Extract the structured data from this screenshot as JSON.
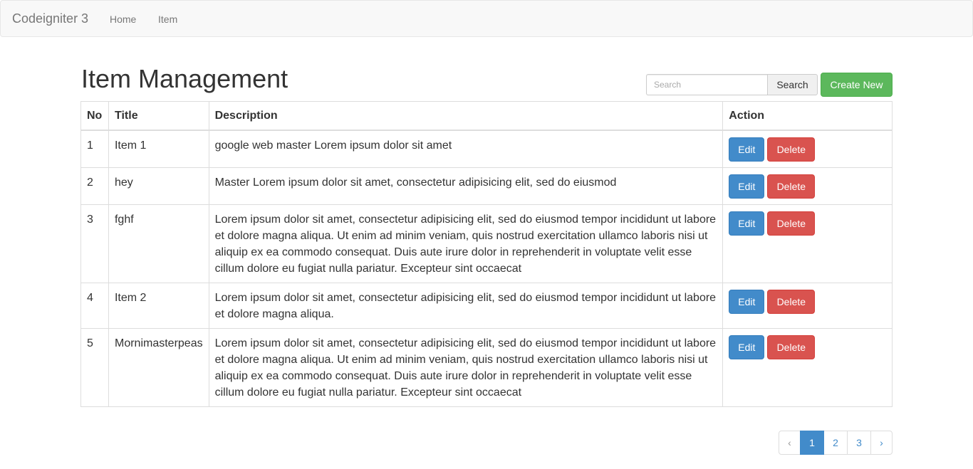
{
  "navbar": {
    "brand": "Codeigniter 3",
    "links": [
      {
        "label": "Home"
      },
      {
        "label": "Item"
      }
    ]
  },
  "page_title": "Item Management",
  "search": {
    "placeholder": "Search",
    "value": "",
    "button_label": "Search"
  },
  "create_button_label": "Create New",
  "table": {
    "headers": [
      "No",
      "Title",
      "Description",
      "Action"
    ],
    "rows": [
      {
        "no": "1",
        "title": "Item 1",
        "description": "google web master Lorem ipsum dolor sit amet",
        "edit_label": "Edit",
        "delete_label": "Delete"
      },
      {
        "no": "2",
        "title": "hey",
        "description": "Master Lorem ipsum dolor sit amet, consectetur adipisicing elit, sed do eiusmod",
        "edit_label": "Edit",
        "delete_label": "Delete"
      },
      {
        "no": "3",
        "title": "fghf",
        "description": "Lorem ipsum dolor sit amet, consectetur adipisicing elit, sed do eiusmod tempor incididunt ut labore et dolore magna aliqua. Ut enim ad minim veniam, quis nostrud exercitation ullamco laboris nisi ut aliquip ex ea commodo consequat. Duis aute irure dolor in reprehenderit in voluptate velit esse cillum dolore eu fugiat nulla pariatur. Excepteur sint occaecat",
        "edit_label": "Edit",
        "delete_label": "Delete"
      },
      {
        "no": "4",
        "title": "Item 2",
        "description": "Lorem ipsum dolor sit amet, consectetur adipisicing elit, sed do eiusmod tempor incididunt ut labore et dolore magna aliqua.",
        "edit_label": "Edit",
        "delete_label": "Delete"
      },
      {
        "no": "5",
        "title": "Mornimasterpeas",
        "description": "Lorem ipsum dolor sit amet, consectetur adipisicing elit, sed do eiusmod tempor incididunt ut labore et dolore magna aliqua. Ut enim ad minim veniam, quis nostrud exercitation ullamco laboris nisi ut aliquip ex ea commodo consequat. Duis aute irure dolor in reprehenderit in voluptate velit esse cillum dolore eu fugiat nulla pariatur. Excepteur sint occaecat",
        "edit_label": "Edit",
        "delete_label": "Delete"
      }
    ]
  },
  "pagination": {
    "prev": "‹",
    "pages": [
      "1",
      "2",
      "3"
    ],
    "active_page": "1",
    "next": "›"
  },
  "colors": {
    "navbar_bg": "#f8f8f8",
    "primary": "#428bca",
    "success": "#5cb85c",
    "danger": "#d9534f"
  }
}
